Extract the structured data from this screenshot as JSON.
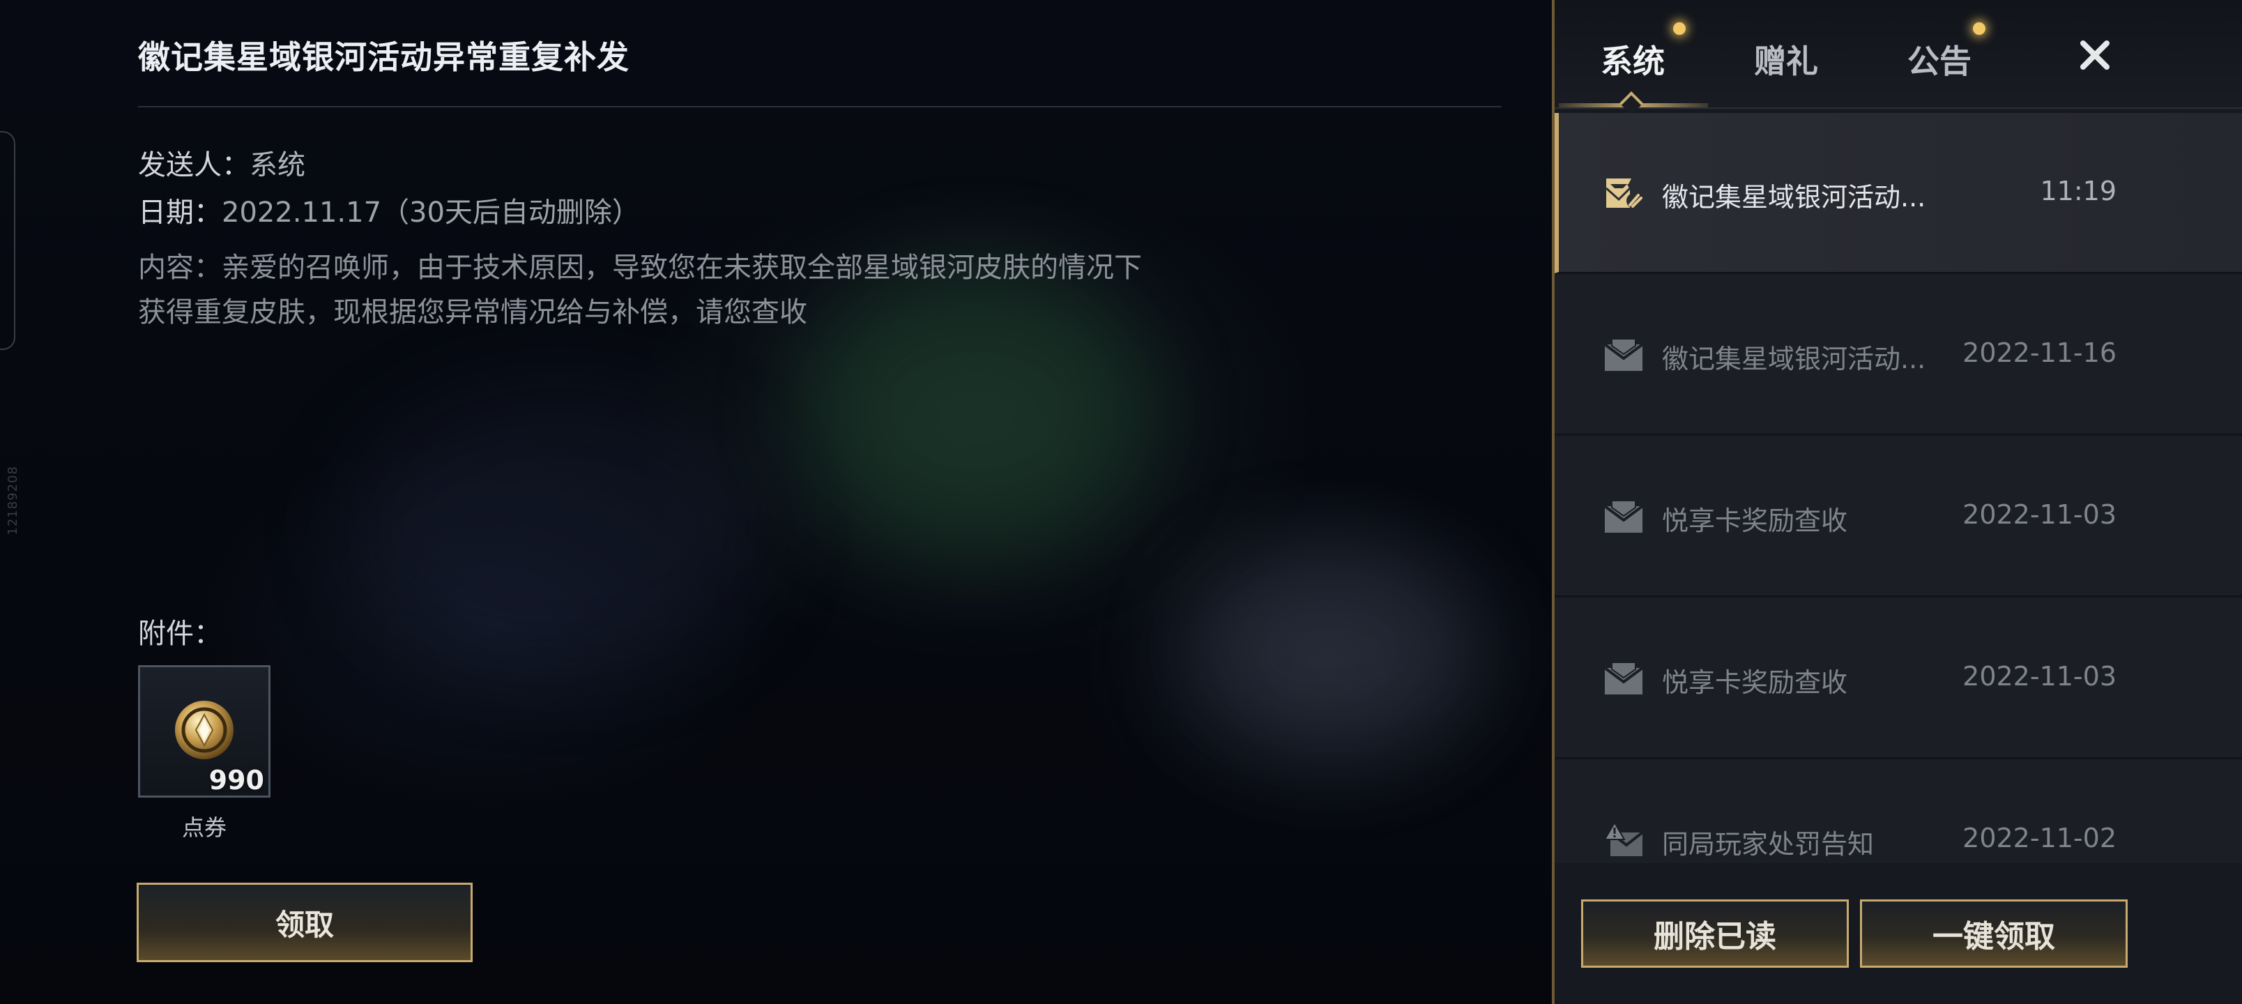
{
  "detail": {
    "title": "徽记集星域银河活动异常重复补发",
    "sender_label": "发送人：",
    "sender_value": "系统",
    "date_label": "日期：",
    "date_value": "2022.11.17（30天后自动删除）",
    "content_label": "内容：",
    "content_text": "亲爱的召唤师，由于技术原因，导致您在未获取全部星域银河皮肤的情况下获得重复皮肤，现根据您异常情况给与补偿，请您查收",
    "attachments_label": "附件：",
    "attachment": {
      "name": "点券",
      "quantity": "990",
      "icon": "coin-icon"
    },
    "claim_label": "领取"
  },
  "side_code": "12189208",
  "tabs": [
    {
      "label": "系统",
      "active": true,
      "has_notification": true
    },
    {
      "label": "赠礼",
      "active": false,
      "has_notification": false
    },
    {
      "label": "公告",
      "active": false,
      "has_notification": true
    }
  ],
  "mail_list": [
    {
      "title": "徽记集星域银河活动...",
      "time": "11:19",
      "icon": "opened-mail-icon",
      "selected": true
    },
    {
      "title": "徽记集星域银河活动...",
      "time": "2022-11-16",
      "icon": "mail-icon",
      "selected": false
    },
    {
      "title": "悦享卡奖励查收",
      "time": "2022-11-03",
      "icon": "mail-icon",
      "selected": false
    },
    {
      "title": "悦享卡奖励查收",
      "time": "2022-11-03",
      "icon": "mail-icon",
      "selected": false
    },
    {
      "title": "同局玩家处罚告知",
      "time": "2022-11-02",
      "icon": "alert-mail-icon",
      "selected": false
    }
  ],
  "footer": {
    "delete_read_label": "删除已读",
    "claim_all_label": "一键领取"
  },
  "colors": {
    "accent_gold": "#c8aa6e",
    "notification_dot": "#f4c865",
    "panel_bg": "#16191f"
  }
}
